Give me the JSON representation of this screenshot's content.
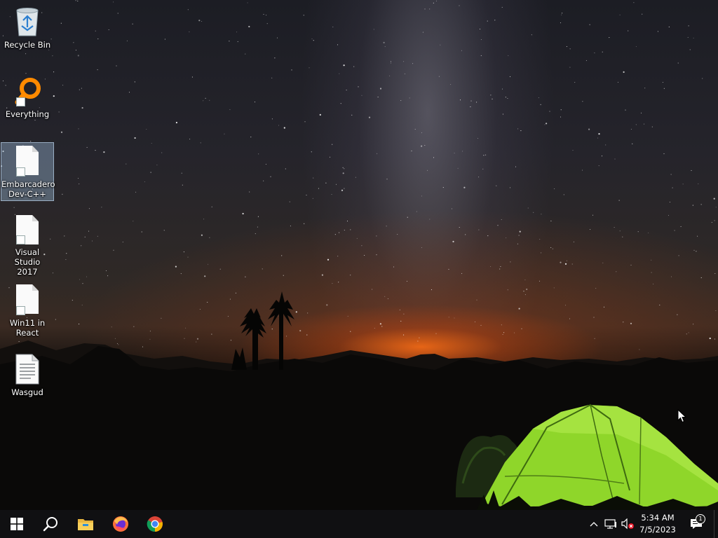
{
  "desktop": {
    "icons": [
      {
        "label": "Recycle Bin",
        "icon": "recycle-bin-icon",
        "selected": false,
        "shortcut": false
      },
      {
        "label": "Everything",
        "icon": "everything-search-icon",
        "selected": false,
        "shortcut": true
      },
      {
        "label": "Embarcadero\nDev-C++",
        "icon": "file-icon",
        "selected": true,
        "shortcut": true
      },
      {
        "label": "Visual Studio\n2017",
        "icon": "file-icon",
        "selected": false,
        "shortcut": true
      },
      {
        "label": "Win11 in\nReact",
        "icon": "file-icon",
        "selected": false,
        "shortcut": true
      },
      {
        "label": "Wasgud",
        "icon": "text-document-icon",
        "selected": false,
        "shortcut": false
      }
    ]
  },
  "taskbar": {
    "pinned": [
      {
        "icon": "windows-start-icon"
      },
      {
        "icon": "search-icon"
      },
      {
        "icon": "file-explorer-icon"
      },
      {
        "icon": "firefox-icon"
      },
      {
        "icon": "chrome-icon"
      }
    ],
    "tray": {
      "time": "5:34 AM",
      "date": "7/5/2023",
      "notification_count": "1",
      "icons": [
        "chevron-up-icon",
        "network-icon",
        "volume-muted-icon"
      ]
    }
  },
  "colors": {
    "taskbar": "#101012",
    "selection": "#96b4d2",
    "tent": "#8fd62a",
    "glow": "#ff6e14"
  }
}
